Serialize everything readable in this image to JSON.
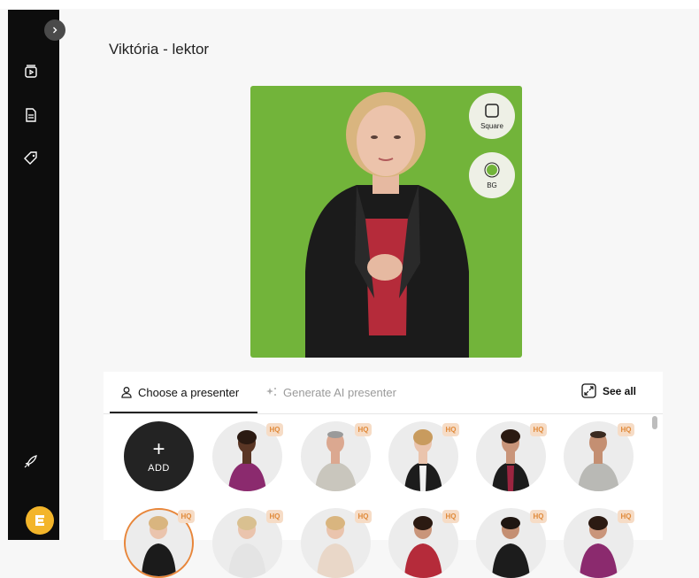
{
  "page": {
    "title": "Viktória - lektor"
  },
  "stage": {
    "controls": [
      {
        "label": "Square",
        "icon": "square-icon"
      },
      {
        "label": "BG",
        "icon": "background-color-icon"
      }
    ]
  },
  "tabs": {
    "choose": "Choose a presenter",
    "generate": "Generate AI presenter",
    "see_all": "See all"
  },
  "add_button": {
    "plus": "+",
    "label": "ADD"
  },
  "hq_label": "HQ",
  "colors": {
    "sidebar": "#0d0d0d",
    "stage_bg": "#72b43a",
    "accent_logo": "#f3b52a",
    "hq_bg": "#f6dcc6",
    "hq_text": "#e08a3a"
  }
}
